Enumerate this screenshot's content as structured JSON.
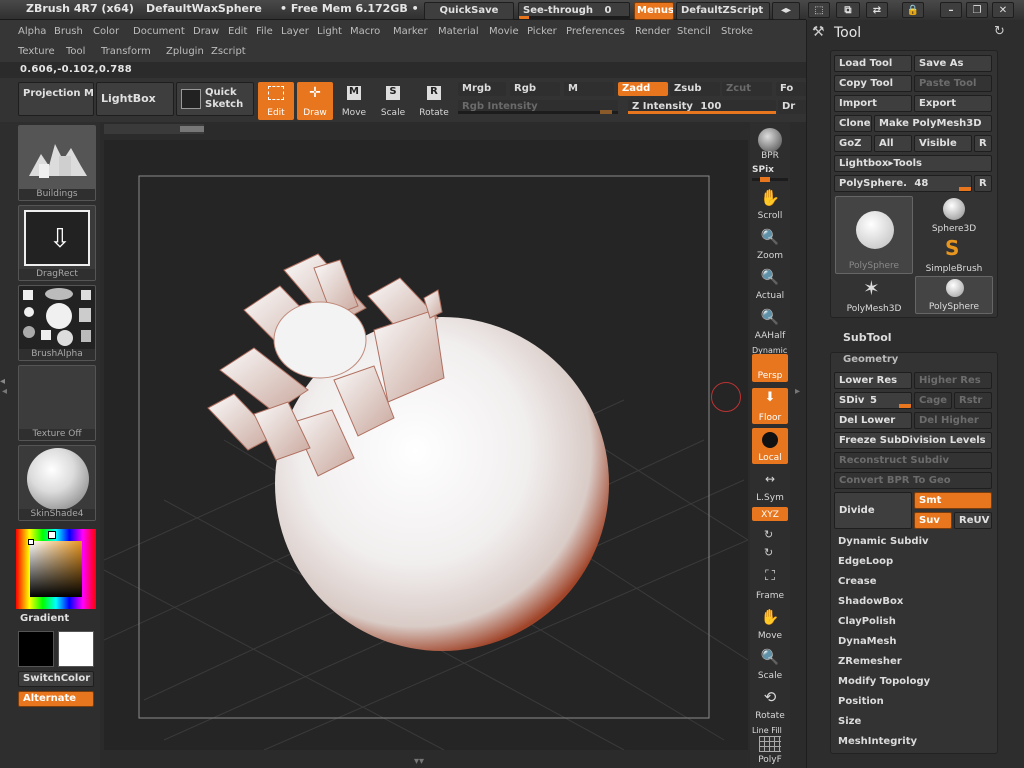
{
  "title_bar": {
    "app": "ZBrush 4R7 (x64)",
    "document": "DefaultWaxSphere",
    "free_mem": "• Free Mem 6.172GB •",
    "quicksave": "QuickSave",
    "see_through": "See-through",
    "see_through_value": "0",
    "menus": "Menus",
    "script": "DefaultZScript"
  },
  "menu_row1": [
    "Alpha",
    "Brush",
    "Color",
    "Document",
    "Draw",
    "Edit",
    "File",
    "Layer",
    "Light",
    "Macro",
    "Marker",
    "Material",
    "Movie",
    "Picker",
    "Preferences",
    "Render",
    "Stencil",
    "Stroke"
  ],
  "menu_row2": [
    "Texture",
    "Tool",
    "Transform",
    "Zplugin",
    "Zscript"
  ],
  "coordinates": "0.606,-0.102,0.788",
  "toolbar": {
    "projection_master": "Projection Master",
    "lightbox": "LightBox",
    "quick_sketch": "Quick Sketch",
    "edit": "Edit",
    "draw": "Draw",
    "move": "Move",
    "scale": "Scale",
    "rotate": "Rotate",
    "mrgb": "Mrgb",
    "rgb": "Rgb",
    "m": "M",
    "zadd": "Zadd",
    "zsub": "Zsub",
    "zcut": "Zcut",
    "focal": "Fo",
    "rgb_intensity": "Rgb Intensity",
    "z_intensity": "Z Intensity",
    "z_intensity_value": "100",
    "draw_size": "Dr"
  },
  "left_shelf": {
    "brush": "Buildings",
    "stroke": "DragRect",
    "alpha": "BrushAlpha",
    "texture": "Texture Off",
    "material": "SkinShade4",
    "gradient": "Gradient",
    "switch_color": "SwitchColor",
    "alternate": "Alternate",
    "main_color": "#000000",
    "secondary_color": "#ffffff"
  },
  "right_shelf": [
    {
      "label": "BPR"
    },
    {
      "label": "SPix"
    },
    {
      "label": "Scroll"
    },
    {
      "label": "Zoom"
    },
    {
      "label": "Actual"
    },
    {
      "label": "AAHalf"
    },
    {
      "label": "Persp",
      "top": "Dynamic"
    },
    {
      "label": "Floor"
    },
    {
      "label": "Local"
    },
    {
      "label": "L.Sym"
    },
    {
      "label": "XYZ"
    },
    {
      "label": "Frame"
    },
    {
      "label": "Move"
    },
    {
      "label": "Scale"
    },
    {
      "label": "Rotate"
    },
    {
      "label": "PolyF",
      "top": "Line Fill"
    }
  ],
  "tool_panel": {
    "title": "Tool",
    "load_tool": "Load Tool",
    "save_as": "Save As",
    "copy_tool": "Copy Tool",
    "paste_tool": "Paste Tool",
    "import": "Import",
    "export": "Export",
    "clone": "Clone",
    "make_polymesh": "Make PolyMesh3D",
    "goz": "GoZ",
    "all": "All",
    "visible": "Visible",
    "r": "R",
    "lightbox_tools": "Lightbox▸Tools",
    "current_tool": "PolySphere.",
    "current_tool_value": "48",
    "tools": [
      "PolySphere",
      "Sphere3D",
      "SimpleBrush",
      "PolyMesh3D",
      "PolySphere"
    ]
  },
  "subtool": "SubTool",
  "geometry": {
    "title": "Geometry",
    "lower_res": "Lower Res",
    "higher_res": "Higher Res",
    "sdiv": "SDiv",
    "sdiv_value": "5",
    "cage": "Cage",
    "rstr": "Rstr",
    "del_lower": "Del Lower",
    "del_higher": "Del Higher",
    "freeze": "Freeze SubDivision Levels",
    "reconstruct": "Reconstruct Subdiv",
    "convert_bpr": "Convert BPR To Geo",
    "divide": "Divide",
    "smt": "Smt",
    "suv": "Suv",
    "reuv": "ReUV"
  },
  "geometry_sections": [
    "Dynamic Subdiv",
    "EdgeLoop",
    "Crease",
    "ShadowBox",
    "ClayPolish",
    "DynaMesh",
    "ZRemesher",
    "Modify Topology",
    "Position",
    "Size",
    "MeshIntegrity"
  ],
  "colors": {
    "accent": "#e8761e",
    "panel": "#333333"
  }
}
